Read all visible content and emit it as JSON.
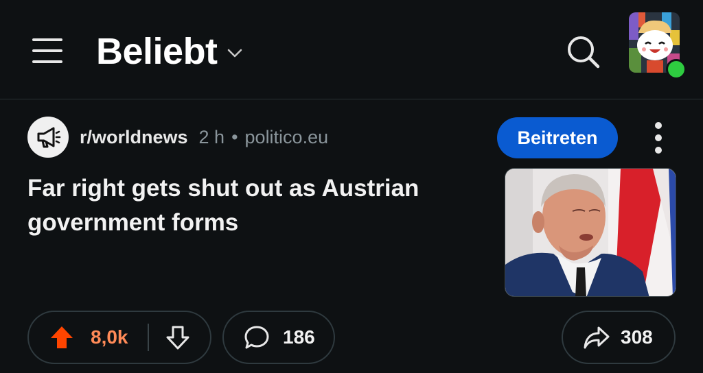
{
  "header": {
    "feed_label": "Beliebt"
  },
  "post": {
    "subreddit": "r/worldnews",
    "age": "2 h",
    "separator": "•",
    "domain": "politico.eu",
    "join_label": "Beitreten",
    "title": "Far right gets shut out as Austrian government forms",
    "upvotes": "8,0k",
    "comments": "186",
    "shares": "308"
  },
  "colors": {
    "background": "#0e1113",
    "join_button": "#0a5bd1",
    "upvote_active": "#ff4500",
    "online_status": "#2ecc40"
  },
  "icons": [
    "menu-icon",
    "chevron-down-icon",
    "search-icon",
    "megaphone-icon",
    "more-vertical-icon",
    "upvote-icon",
    "downvote-icon",
    "comment-icon",
    "share-icon"
  ]
}
